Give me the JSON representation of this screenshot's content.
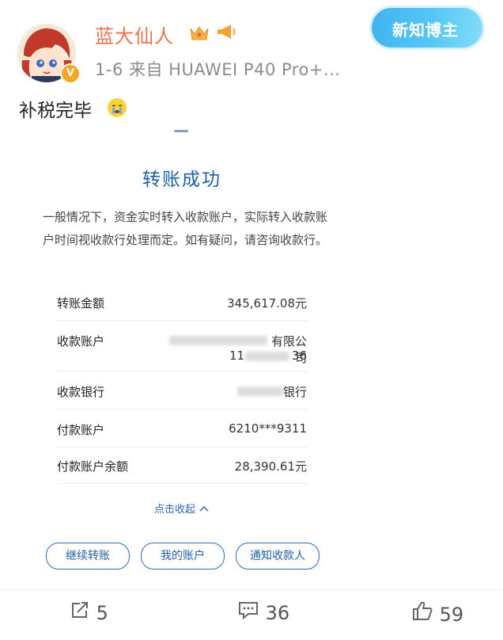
{
  "header": {
    "username": "蓝大仙人",
    "meta": "1-6  来自 HUAWEI P40 Pro+...",
    "verified_badge": "V",
    "new_blogger_badge": "新知博主"
  },
  "post": {
    "text": "补税完毕"
  },
  "card": {
    "title": "转账成功",
    "description": "一般情况下，资金实时转入收款账户，实际转入收款账户时间视收款行处理而定。如有疑问，请咨询收款行。",
    "rows": [
      {
        "label": "转账金额",
        "value": "345,617.08元"
      },
      {
        "label": "收款账户",
        "value_line1": "有限公司",
        "value_line2_start": "11",
        "value_line2_end": "36"
      },
      {
        "label": "收款银行",
        "value": "银行"
      },
      {
        "label": "付款账户",
        "value": "6210***9311"
      },
      {
        "label": "付款账户余额",
        "value": "28,390.61元"
      }
    ],
    "collapse_label": "点击收起",
    "buttons": [
      "继续转账",
      "我的账户",
      "通知收款人"
    ]
  },
  "actions": {
    "share": "5",
    "comment": "36",
    "like": "59"
  },
  "colors": {
    "username": "#eb7350",
    "card_title": "#1f5fa6",
    "button_border": "#2f6ab6",
    "meta": "#8c8c8c"
  }
}
